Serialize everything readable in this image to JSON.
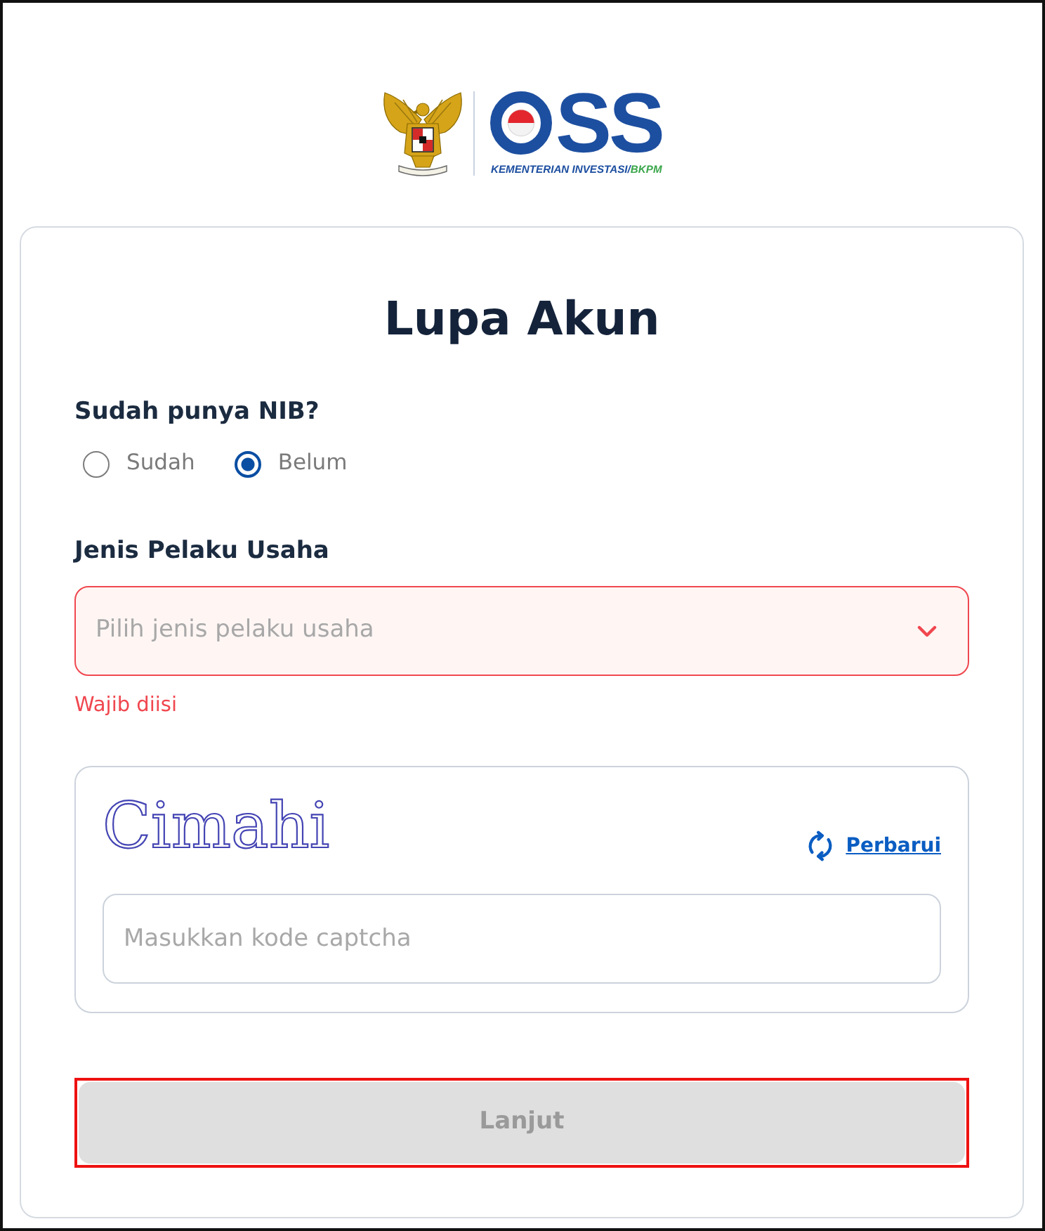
{
  "logo": {
    "wordmark": "SS",
    "ministry": "KEMENTERIAN INVESTASI/",
    "agency": "BKPM"
  },
  "form": {
    "title": "Lupa Akun",
    "nib_question": {
      "label": "Sudah punya NIB?",
      "options": [
        {
          "label": "Sudah",
          "selected": false
        },
        {
          "label": "Belum",
          "selected": true
        }
      ]
    },
    "business_type": {
      "label": "Jenis Pelaku Usaha",
      "placeholder": "Pilih jenis pelaku usaha",
      "invalid": true,
      "error": "Wajib diisi"
    },
    "captcha": {
      "code": "Cimahi",
      "refresh_label": "Perbarui",
      "placeholder": "Masukkan kode captcha"
    },
    "submit_button": {
      "label": "Lanjut",
      "disabled": true,
      "highlighted": true
    }
  }
}
